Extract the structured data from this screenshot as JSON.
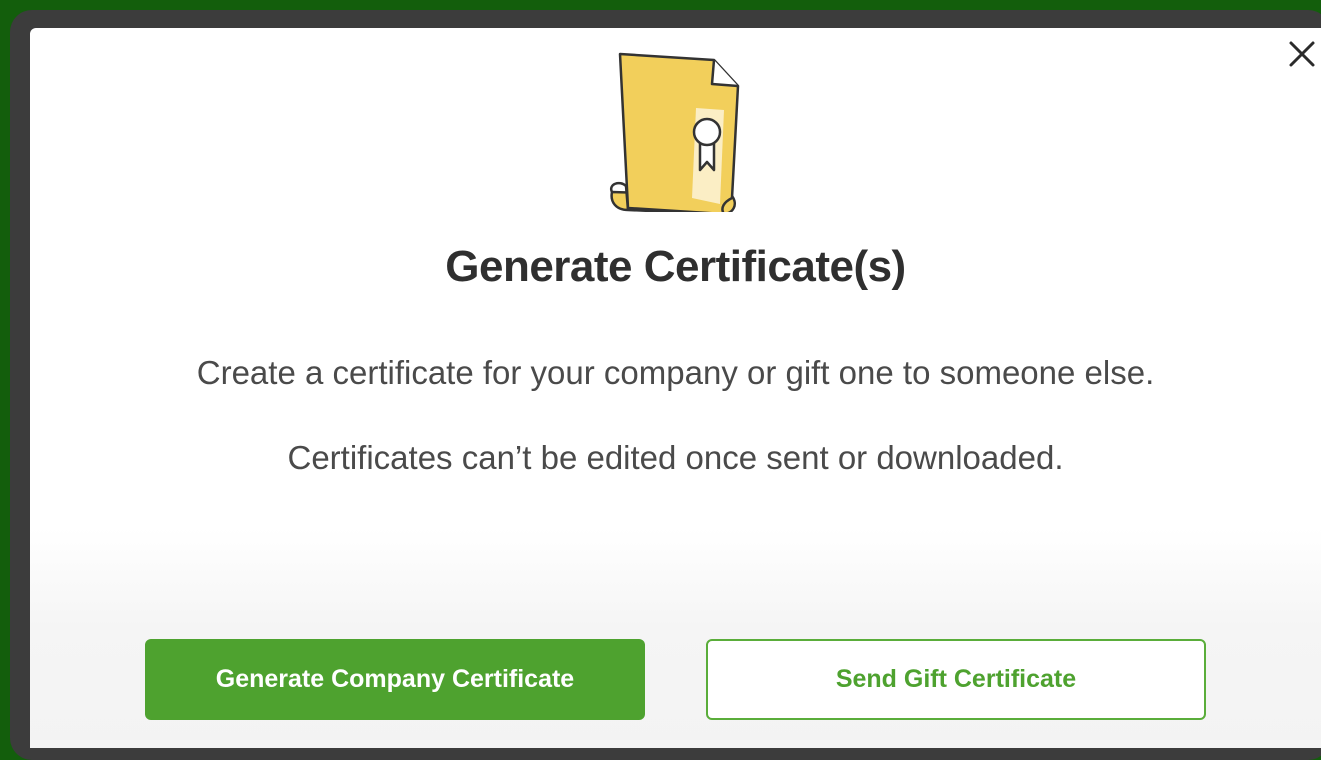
{
  "modal": {
    "title": "Generate Certificate(s)",
    "description_line1": "Create a certificate for your company or gift one to someone else.",
    "description_line2": "Certificates can’t be edited once sent or downloaded.",
    "close_icon": "close-icon",
    "illustration_icon": "certificate-document-icon"
  },
  "actions": {
    "primary_label": "Generate Company Certificate",
    "secondary_label": "Send Gift Certificate"
  },
  "colors": {
    "background": "#135e0c",
    "accent": "#4ea22f",
    "certificate_yellow": "#f2cf5b"
  }
}
